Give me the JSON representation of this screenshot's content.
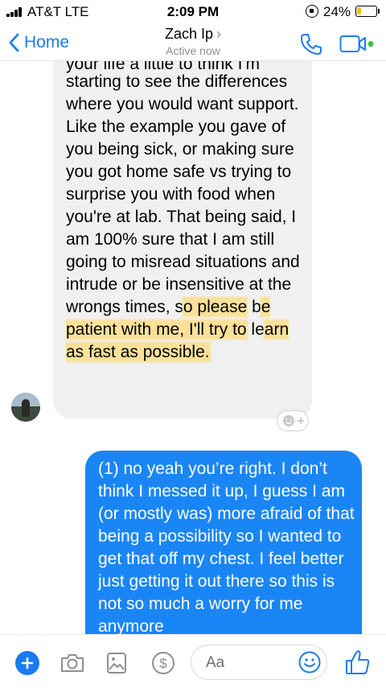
{
  "status_bar": {
    "carrier": "AT&T  LTE",
    "time": "2:09 PM",
    "battery_percent": "24%",
    "battery_level": 0.24,
    "battery_color": "#f3c400"
  },
  "nav": {
    "back_label": "Home",
    "contact_name": "Zach Ip",
    "contact_status": "Active now",
    "accent_color": "#1a7cf0",
    "icons": [
      "chevron-left-icon",
      "phone-icon",
      "video-camera-icon"
    ]
  },
  "messages": {
    "incoming": {
      "cut_line": "your life a little to think I'm",
      "text_plain": "starting to see the differences where you would want support. Like the example you gave of you being sick, or making sure you got home safe vs trying to surprise you with food when you're at lab. That being said, I am 100% sure that I am still going to misread situations and intrude or be insensitive at the wrongs times, s",
      "highlighted_1": "o please",
      "text_mid": " b",
      "highlighted_2": "e patient with me, I'll try to",
      "text_mid_2": " le",
      "highlighted_3": "arn as fast as possible.",
      "bubble_color": "#f0f0f0",
      "highlight_color": "#ffd966"
    },
    "outgoing": {
      "text": "(1) no yeah you’re right. I don’t think I messed it up, I guess I am (or mostly was) more afraid of that being a possibility so I wanted to get that off my chest. I feel better just getting it out there so this is not so much a worry for me anymore",
      "bubble_color": "#1a86f5"
    }
  },
  "composer": {
    "placeholder": "Aa",
    "icons": [
      "plus-icon",
      "camera-icon",
      "image-icon",
      "dollar-icon",
      "smiley-icon",
      "thumbs-up-icon"
    ]
  }
}
